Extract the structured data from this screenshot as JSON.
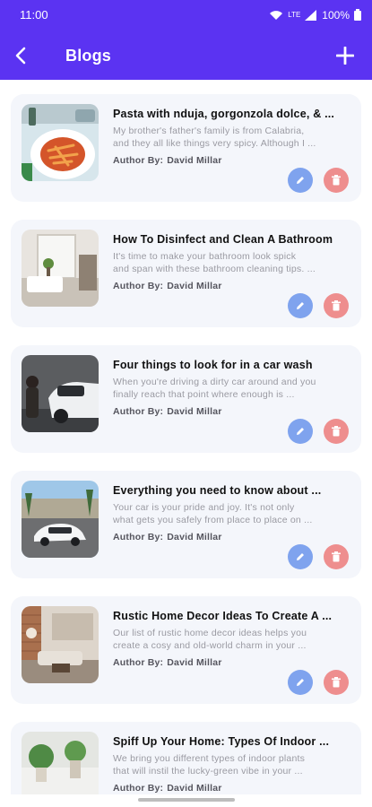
{
  "status": {
    "time": "11:00",
    "battery": "100%",
    "network": "LTE"
  },
  "header": {
    "title": "Blogs"
  },
  "colors": {
    "primary": "#5b33f2",
    "edit": "#7fa3ee",
    "delete": "#ee8e8e"
  },
  "blogs": [
    {
      "title": "Pasta with nduja, gorgonzola dolce, & ...",
      "desc1": "My brother's father's family is from Calabria,",
      "desc2": "and they all like things very spicy. Although I ...",
      "author_label": "Author By:",
      "author": "David Millar"
    },
    {
      "title": "How To Disinfect and Clean A Bathroom",
      "desc1": "It's time to make your bathroom look spick",
      "desc2": "and span with these bathroom cleaning tips. ...",
      "author_label": "Author By:",
      "author": "David Millar"
    },
    {
      "title": "Four things to look for in a car wash",
      "desc1": "When you're driving a dirty car around and you",
      "desc2": "finally reach that point where enough is ...",
      "author_label": "Author By:",
      "author": "David Millar"
    },
    {
      "title": "Everything you need to know about ...",
      "desc1": "Your car is your pride and joy. It's not only",
      "desc2": "what gets you safely from place to place on ...",
      "author_label": "Author By:",
      "author": "David Millar"
    },
    {
      "title": "Rustic Home Decor Ideas To Create A ...",
      "desc1": "Our list of rustic home decor ideas helps you",
      "desc2": "create a cosy and old-world charm in your ...",
      "author_label": "Author By:",
      "author": "David Millar"
    },
    {
      "title": "Spiff Up Your Home: Types Of Indoor ...",
      "desc1": "We bring you different types of indoor plants",
      "desc2": "that will instil the lucky-green vibe in your ...",
      "author_label": "Author By:",
      "author": "David Millar"
    }
  ]
}
